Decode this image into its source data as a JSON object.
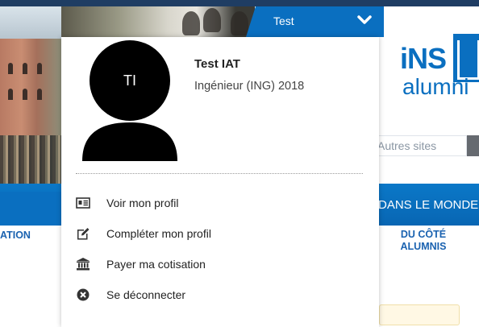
{
  "user_bar": {
    "name": "Test"
  },
  "search": {
    "placeholder": "Autres sites"
  },
  "nav": {
    "band_right": "DANS LE MONDE",
    "left_label": "ATION",
    "right_label_line1": "DU CÔTÉ",
    "right_label_line2": "ALUMNIS"
  },
  "logo": {
    "line1": "iNS",
    "line2": "alumni"
  },
  "profile": {
    "initials": "TI",
    "name": "Test IAT",
    "subtitle": "Ingénieur (ING) 2018"
  },
  "menu": {
    "items": [
      {
        "label": "Voir mon profil",
        "icon": "id-card-icon"
      },
      {
        "label": "Compléter mon profil",
        "icon": "edit-icon"
      },
      {
        "label": "Payer ma cotisation",
        "icon": "bank-icon"
      },
      {
        "label": "Se déconnecter",
        "icon": "close-circle-icon"
      }
    ]
  },
  "colors": {
    "primary_blue": "#0a6fc0",
    "navy": "#1f3d63",
    "nav_text": "#1a62b0"
  }
}
